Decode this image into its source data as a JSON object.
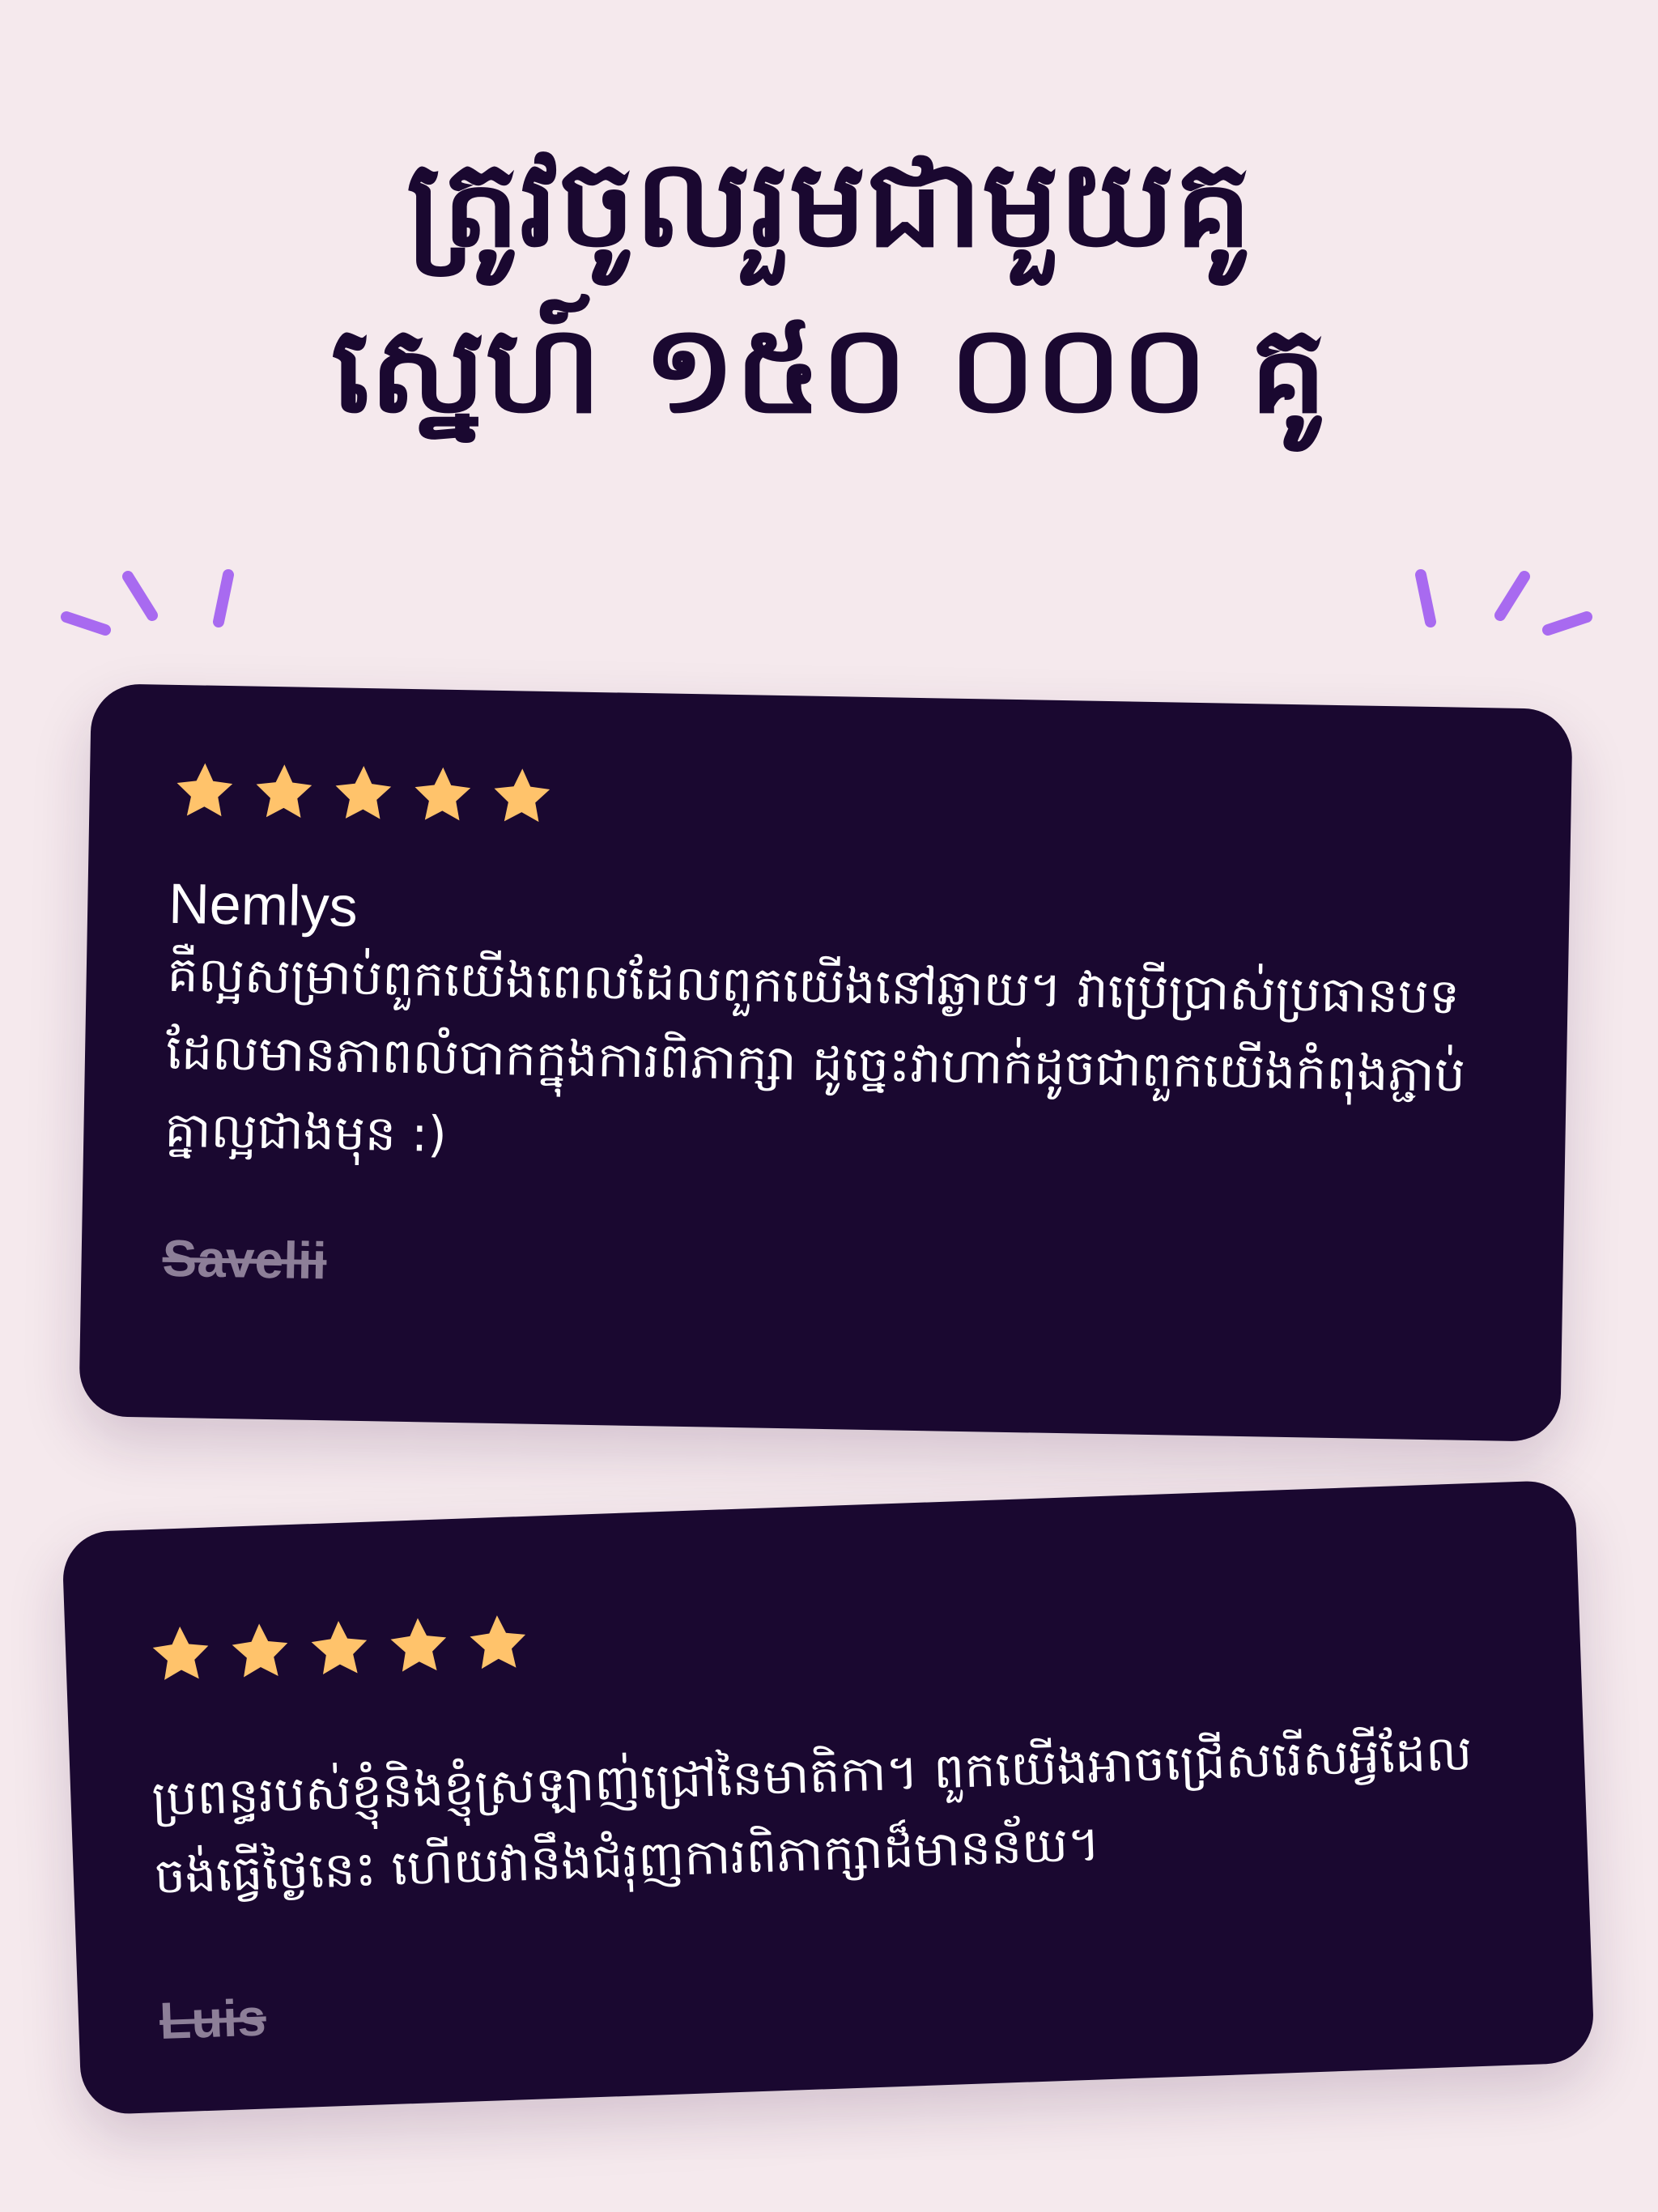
{
  "headline": {
    "line1": "ត្រូវចូលរួមជាមួយគូ",
    "line2": "ស្នេហ៍ ១៥០ ០០០ គូ"
  },
  "colors": {
    "background": "#f5e9ed",
    "card": "#1a0830",
    "star": "#ffc36b",
    "accent": "#a86af0",
    "muted": "#8d7f98"
  },
  "decorations": [
    "sparkle-lines-left",
    "sparkle-lines-right"
  ],
  "reviews": [
    {
      "rating": 5,
      "reviewer": "Nemlys",
      "text": "គឺល្អសម្រាប់ពួកយើងពេលដែលពួកយើងនៅឆ្ងាយ។ វាប្រើប្រាស់ប្រធានបទដែលមានភាពលំបាកក្នុងការពិភាក្សា ដូច្នេះវាហាក់ដូចជាពួកយើងកំពុងភ្ជាប់គ្នាល្អជាងមុន :)",
      "author": "Savelii"
    },
    {
      "rating": 5,
      "reviewer": "",
      "text": "ប្រពន្ធរបស់ខ្ញុំនិងខ្ញុំស្រឡាញ់ជ្រៅនៃមាតិកា។ ពួកយើងអាចជ្រើសរើសអ្វីដែលចង់ធ្វើថ្ងៃនេះ ហើយវានឹងជំរុញការពិភាក្សាដ៏មានន័យ។",
      "author": "Luis"
    }
  ]
}
